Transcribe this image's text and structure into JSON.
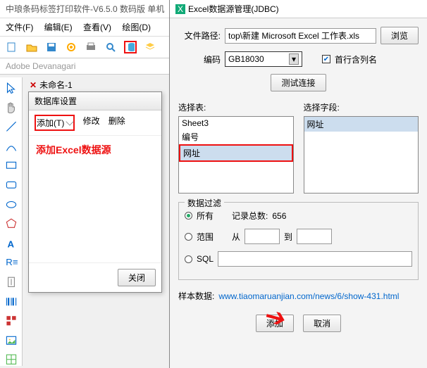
{
  "app": {
    "title": "中琅条码标签打印软件-V6.5.0 数码版 单机"
  },
  "menu": {
    "file": "文件(F)",
    "edit": "编辑(E)",
    "view": "查看(V)",
    "draw": "绘图(D)"
  },
  "font": {
    "name": "Adobe Devanagari"
  },
  "doc": {
    "tab": "未命名-1"
  },
  "db": {
    "title": "数据库设置",
    "add": "添加(T)",
    "modify": "修改",
    "delete": "删除",
    "hint": "添加Excel数据源",
    "close": "关闭"
  },
  "dlg": {
    "title": "Excel数据源管理(JDBC)",
    "path_label": "文件路径:",
    "path_value": "top\\新建 Microsoft Excel 工作表.xls",
    "browse": "浏览",
    "enc_label": "编码",
    "enc_value": "GB18030",
    "header_cb": "首行含列名",
    "test": "测试连接",
    "tbl_label": "选择表:",
    "fld_label": "选择字段:",
    "tables": [
      "Sheet3",
      "编号",
      "网址"
    ],
    "fields": [
      "网址"
    ],
    "filter": {
      "title": "数据过滤",
      "all": "所有",
      "count_label": "记录总数:",
      "count": "656",
      "range": "范围",
      "from": "从",
      "to": "到",
      "sql": "SQL"
    },
    "sample_label": "样本数据:",
    "sample_link": "www.tiaomaruanjian.com/news/6/show-431.html",
    "add": "添加",
    "cancel": "取消"
  }
}
